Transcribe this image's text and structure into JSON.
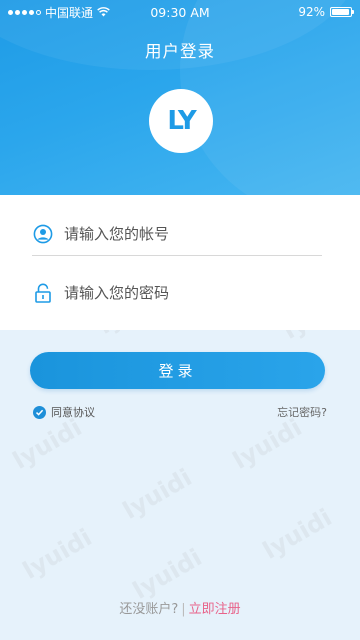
{
  "status_bar": {
    "carrier": "中国联通",
    "time": "09:30 AM",
    "battery": "92%",
    "battery_level": 0.92
  },
  "header": {
    "title": "用户登录",
    "logo_text": "LY"
  },
  "form": {
    "account_placeholder": "请输入您的帐号",
    "password_placeholder": "请输入您的密码",
    "account_icon": "user-circle-icon",
    "password_icon": "lock-icon"
  },
  "login_button": "登录",
  "agree_label": "同意协议",
  "forgot_label": "忘记密码?",
  "bottom": {
    "question": "还没账户?",
    "separator": "|",
    "register": "立即注册"
  },
  "watermark": "lyuidi",
  "colors": {
    "primary": "#1e9be6",
    "accent_pink": "#e8638a",
    "background": "#e6f2fb"
  }
}
